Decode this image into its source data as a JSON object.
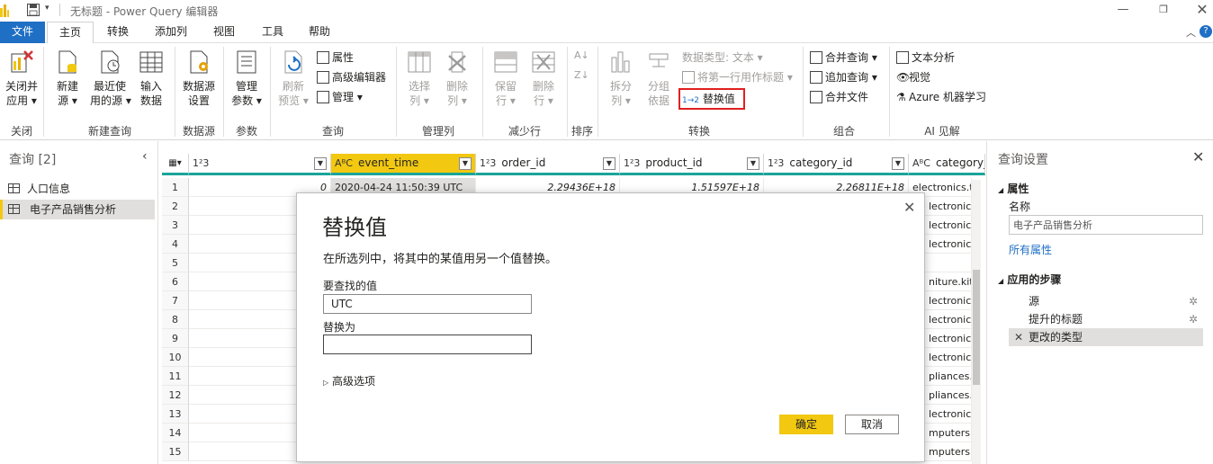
{
  "window": {
    "title": "无标题 - Power Query 编辑器"
  },
  "tabs": [
    {
      "label": "文件"
    },
    {
      "label": "主页"
    },
    {
      "label": "转换"
    },
    {
      "label": "添加列"
    },
    {
      "label": "视图"
    },
    {
      "label": "工具"
    },
    {
      "label": "帮助"
    }
  ],
  "ribbon": {
    "close": {
      "btn1": "关闭并",
      "btn1b": "应用",
      "group": "关闭"
    },
    "newquery": {
      "btn1": "新建",
      "btn1b": "源",
      "btn2": "最近使",
      "btn2b": "用的源",
      "btn3": "输入",
      "btn3b": "数据",
      "group": "新建查询"
    },
    "datasource": {
      "btn1": "数据源",
      "btn1b": "设置",
      "group": "数据源"
    },
    "params": {
      "btn1": "管理",
      "btn1b": "参数",
      "group": "参数"
    },
    "query": {
      "btn1": "刷新",
      "btn1b": "预览",
      "props": "属性",
      "adv": "高级编辑器",
      "manage": "管理",
      "group": "查询"
    },
    "managecols": {
      "btn1": "选择",
      "btn1b": "列",
      "btn2": "删除",
      "btn2b": "列",
      "group": "管理列"
    },
    "reducerows": {
      "btn1": "保留",
      "btn1b": "行",
      "btn2": "删除",
      "btn2b": "行",
      "group": "减少行"
    },
    "sort": {
      "group": "排序"
    },
    "transform": {
      "btn1": "拆分",
      "btn1b": "列",
      "btn2": "分组",
      "btn2b": "依据",
      "dtype": "数据类型: 文本",
      "firstrow": "将第一行用作标题",
      "replace": "替换值",
      "group": "转换"
    },
    "combine": {
      "merge": "合并查询",
      "append": "追加查询",
      "files": "合并文件",
      "group": "组合"
    },
    "ai": {
      "text": "文本分析",
      "vision": "视觉",
      "azure": "Azure 机器学习",
      "group": "AI 见解"
    }
  },
  "queries": {
    "header": "查询 [2]",
    "items": [
      {
        "label": "人口信息"
      },
      {
        "label": "电子产品销售分析"
      }
    ]
  },
  "grid": {
    "columns": [
      {
        "type": "1²3",
        "name": ""
      },
      {
        "type": "AᴮC",
        "name": "event_time"
      },
      {
        "type": "1²3",
        "name": "order_id"
      },
      {
        "type": "1²3",
        "name": "product_id"
      },
      {
        "type": "1²3",
        "name": "category_id"
      },
      {
        "type": "AᴮC",
        "name": "category_co"
      }
    ],
    "row_numbers": [
      "1",
      "2",
      "3",
      "4",
      "5",
      "6",
      "7",
      "8",
      "9",
      "10",
      "11",
      "12",
      "13",
      "14",
      "15"
    ],
    "row1": {
      "c0": "0",
      "c1": "2020-04-24 11:50:39 UTC",
      "c2": "2.29436E+18",
      "c3": "1.51597E+18",
      "c4": "2.26811E+18",
      "c5": "electronics.ta"
    },
    "lastcol": [
      "lectronics.ta",
      "lectronics.a",
      "lectronics.a",
      "",
      "niture.kitc",
      "lectronics.s",
      "lectronics.s",
      "lectronics.s",
      "lectronics.s",
      "pliances.ki",
      "pliances.p",
      "lectronics.v",
      "mputers.co",
      "mputers.co"
    ]
  },
  "settings": {
    "title": "查询设置",
    "props_header": "属性",
    "name_label": "名称",
    "name_value": "电子产品销售分析",
    "all_props": "所有属性",
    "steps_header": "应用的步骤",
    "steps": [
      {
        "label": "源"
      },
      {
        "label": "提升的标题"
      },
      {
        "label": "更改的类型"
      }
    ]
  },
  "dialog": {
    "title": "替换值",
    "desc": "在所选列中，将其中的某值用另一个值替换。",
    "find_label": "要查找的值",
    "find_value": "UTC",
    "replace_label": "替换为",
    "replace_value": "",
    "advanced": "高级选项",
    "ok": "确定",
    "cancel": "取消"
  },
  "colors": {
    "accent": "#f2c811",
    "file_tab": "#1f6fc5",
    "highlight_box": "#e02020",
    "teal": "#1aa59b"
  }
}
